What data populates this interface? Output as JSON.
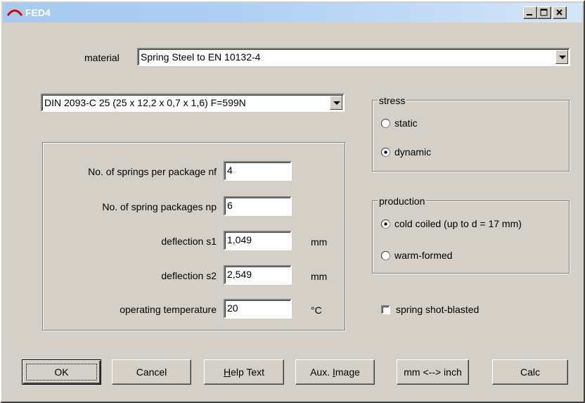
{
  "window": {
    "title": "FED4"
  },
  "material": {
    "label": "material",
    "value": "Spring Steel to EN 10132-4"
  },
  "spring_select": {
    "value": "DIN 2093-C 25 (25 x 12,2 x 0,7 x 1,6)  F=599N"
  },
  "params": [
    {
      "label": "No. of springs per package nf",
      "value": "4",
      "unit": ""
    },
    {
      "label": "No. of spring packages np",
      "value": "6",
      "unit": ""
    },
    {
      "label": "deflection s1",
      "value": "1,049",
      "unit": "mm"
    },
    {
      "label": "deflection s2",
      "value": "2,549",
      "unit": "mm"
    },
    {
      "label": "operating temperature",
      "value": "20",
      "unit": "°C"
    }
  ],
  "stress": {
    "title": "stress",
    "options": [
      "static",
      "dynamic"
    ],
    "selected": "dynamic"
  },
  "production": {
    "title": "production",
    "options": [
      "cold coiled (up to d = 17 mm)",
      "warm-formed"
    ],
    "selected": "cold coiled (up to d = 17 mm)"
  },
  "shot_blasted": {
    "label": "spring shot-blasted",
    "checked": false
  },
  "buttons": {
    "ok": "OK",
    "cancel": "Cancel",
    "help_pre": "",
    "help_u": "H",
    "help_post": "elp Text",
    "aux_pre": "Aux. ",
    "aux_u": "I",
    "aux_post": "mage",
    "units": "mm <--> inch",
    "calc": "Calc"
  }
}
